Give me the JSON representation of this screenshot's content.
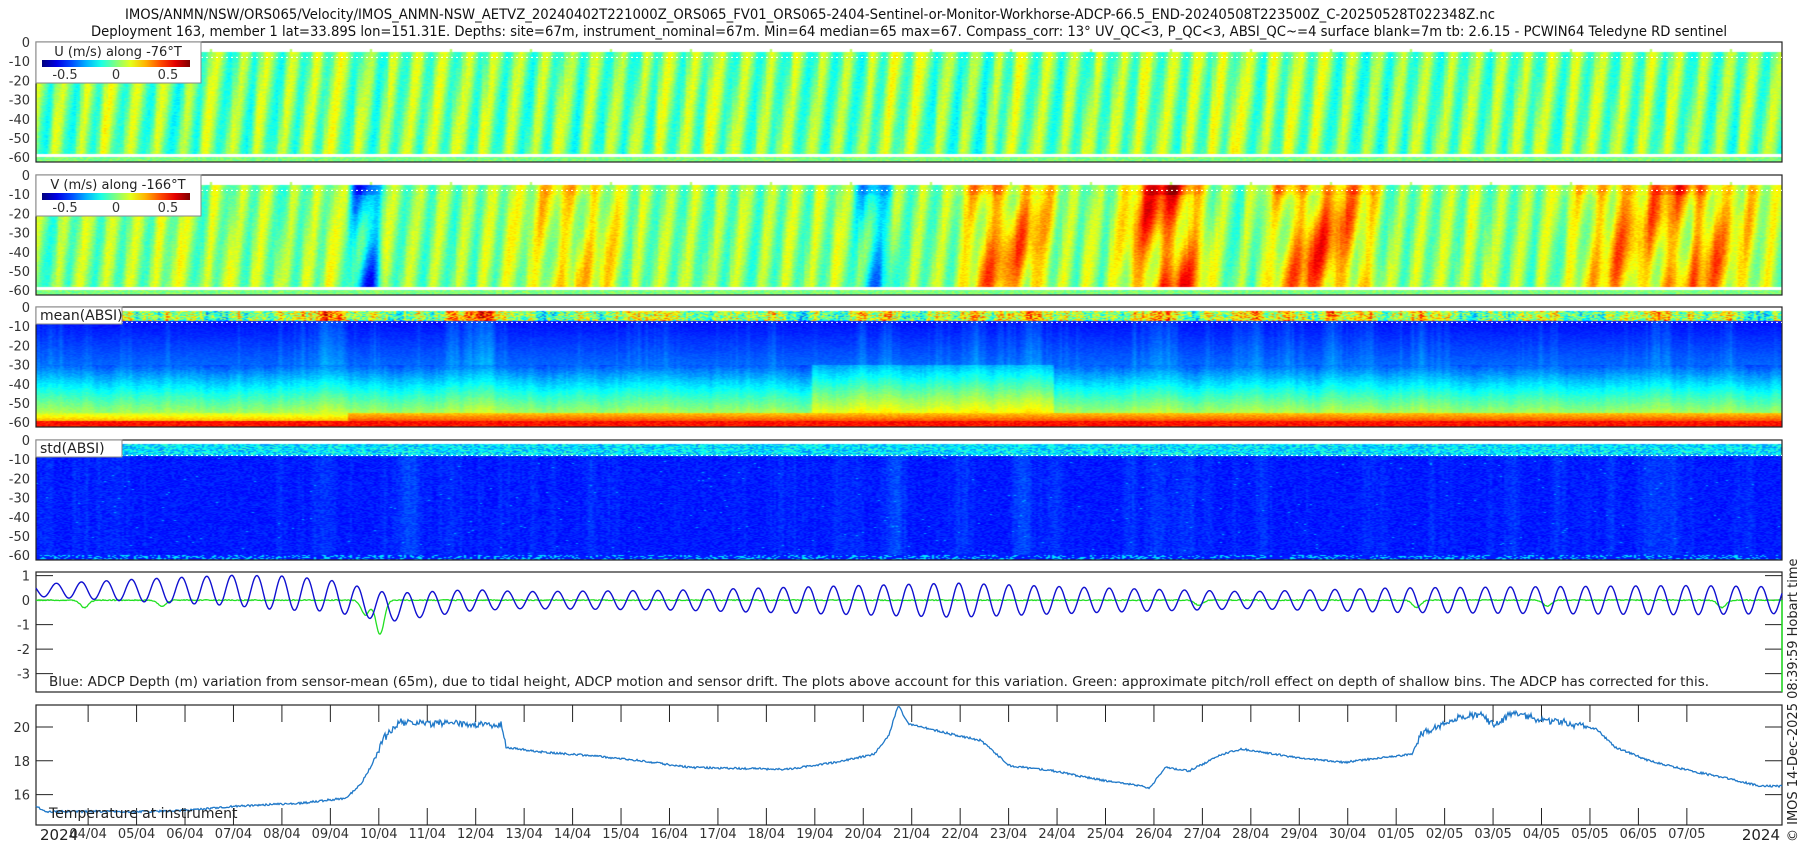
{
  "header": {
    "title_line1": "IMOS/ANMN/NSW/ORS065/Velocity/IMOS_ANMN-NSW_AETVZ_20240402T221000Z_ORS065_FV01_ORS065-2404-Sentinel-or-Monitor-Workhorse-ADCP-66.5_END-20240508T223500Z_C-20250528T022348Z.nc",
    "title_line2": "Deployment 163, member 1 lat=33.89S lon=151.31E. Depths: site=67m, instrument_nominal=67m. Min=64 median=65 max=67. Compass_corr: 13° UV_QC<3, P_QC<3, ABSI_QC~=4 surface blank=7m tb: 2.6.15 - PCWIN64 Teledyne RD sentinel"
  },
  "footer": {
    "copyright": "© IMOS 14-Dec-2025 08:39:59 Hobart time",
    "year_left": "2024",
    "year_right": "2024"
  },
  "colors": {
    "depth_line": "#1010d0",
    "pitch_line": "#22e022",
    "temp_line": "#1f78c8"
  },
  "chart_data": [
    {
      "type": "heatmap",
      "id": "u",
      "label": "U (m/s) along -76°T",
      "colormap": "jet",
      "clim": [
        -0.7,
        0.7
      ],
      "colorbar_ticks": [
        "-0.5",
        "0",
        "0.5"
      ],
      "y_ticks": [
        "0",
        "-10",
        "-20",
        "-30",
        "-40",
        "-50",
        "-60"
      ],
      "ylim": [
        0,
        62.5
      ],
      "baseline": 0.0,
      "noise": 0.14,
      "features": []
    },
    {
      "type": "heatmap",
      "id": "v",
      "label": "V (m/s) along -166°T",
      "colormap": "jet",
      "clim": [
        -0.7,
        0.7
      ],
      "colorbar_ticks": [
        "-0.5",
        "0",
        "0.5"
      ],
      "y_ticks": [
        "0",
        "-10",
        "-20",
        "-30",
        "-40",
        "-50",
        "-60"
      ],
      "ylim": [
        0,
        62.5
      ],
      "baseline": 0.02,
      "noise": 0.12,
      "features": [
        {
          "days": [
            6.4,
            7.2
          ],
          "value": -0.55
        },
        {
          "days": [
            9.7,
            12.5
          ],
          "value": 0.22
        },
        {
          "days": [
            16.8,
            17.8
          ],
          "value": -0.35
        },
        {
          "days": [
            18.9,
            21.3
          ],
          "value": 0.45
        },
        {
          "days": [
            22.2,
            24.4
          ],
          "value": 0.55
        },
        {
          "days": [
            25.1,
            27.9
          ],
          "value": 0.5
        },
        {
          "days": [
            31.2,
            36.0
          ],
          "value": 0.4
        }
      ]
    },
    {
      "type": "heatmap",
      "id": "mean",
      "label": "mean(ABSI)",
      "colormap": "jet",
      "y_ticks": [
        "0",
        "-10",
        "-20",
        "-30",
        "-40",
        "-50",
        "-60"
      ],
      "ylim": [
        0,
        62.5
      ]
    },
    {
      "type": "heatmap",
      "id": "std",
      "label": "std(ABSI)",
      "colormap": "jet",
      "y_ticks": [
        "0",
        "-10",
        "-20",
        "-30",
        "-40",
        "-50",
        "-60"
      ],
      "ylim": [
        0,
        62.5
      ]
    },
    {
      "type": "line",
      "id": "depth",
      "caption": "Blue: ADCP Depth (m) variation from sensor-mean (65m), due to tidal height, ADCP motion and sensor drift. The plots above account for this variation. Green: approximate pitch/roll effect on depth of shallow bins. The ADCP has corrected for this.",
      "ylim": [
        3.75,
        -1.15
      ],
      "y_ticks": [
        {
          "v": -1,
          "label": "1"
        },
        {
          "v": 0,
          "label": "0"
        },
        {
          "v": 1,
          "label": "-1"
        },
        {
          "v": 2,
          "label": "-2"
        },
        {
          "v": 3,
          "label": "-3"
        }
      ],
      "tide_period_days": 0.5175,
      "tide_amplitude": [
        [
          0,
          0.25
        ],
        [
          2,
          0.45
        ],
        [
          5,
          0.7
        ],
        [
          7,
          0.6
        ],
        [
          10,
          0.35
        ],
        [
          13,
          0.4
        ],
        [
          16,
          0.55
        ],
        [
          19,
          0.7
        ],
        [
          22,
          0.5
        ],
        [
          25,
          0.35
        ],
        [
          28,
          0.5
        ],
        [
          31,
          0.55
        ],
        [
          34,
          0.6
        ],
        [
          36,
          0.55
        ]
      ],
      "mean_offset": [
        [
          0,
          -0.4
        ],
        [
          4,
          -0.4
        ],
        [
          6,
          -0.2
        ],
        [
          7.3,
          0.3
        ],
        [
          9,
          0
        ],
        [
          36,
          0
        ]
      ],
      "pitch_dips": [
        [
          1.0,
          0.3
        ],
        [
          2.6,
          0.25
        ],
        [
          6.8,
          0.6
        ],
        [
          7.1,
          1.4
        ],
        [
          24.0,
          0.2
        ],
        [
          28.5,
          0.3
        ],
        [
          31.2,
          0.25
        ],
        [
          34.8,
          0.3
        ]
      ]
    },
    {
      "type": "line",
      "id": "temp",
      "label": "Temperature at instrument",
      "ylim": [
        14.2,
        21.3
      ],
      "y_ticks": [
        "16",
        "18",
        "20"
      ],
      "xlabel_ticks": [
        "04/04",
        "05/04",
        "06/04",
        "07/04",
        "08/04",
        "09/04",
        "10/04",
        "11/04",
        "12/04",
        "13/04",
        "14/04",
        "15/04",
        "16/04",
        "17/04",
        "18/04",
        "19/04",
        "20/04",
        "21/04",
        "22/04",
        "23/04",
        "24/04",
        "25/04",
        "26/04",
        "27/04",
        "28/04",
        "29/04",
        "30/04",
        "01/05",
        "02/05",
        "03/05",
        "04/05",
        "05/05",
        "06/05",
        "07/05"
      ],
      "first_tick_day": 1.076,
      "total_days": 36.04,
      "points": [
        [
          0,
          15.3
        ],
        [
          0.2,
          15.0
        ],
        [
          2.5,
          15.0
        ],
        [
          3.3,
          15.1
        ],
        [
          4.0,
          15.3
        ],
        [
          5.5,
          15.5
        ],
        [
          6.4,
          15.8
        ],
        [
          6.7,
          16.6
        ],
        [
          6.9,
          17.6
        ],
        [
          7.2,
          19.4
        ],
        [
          7.5,
          20.3
        ],
        [
          8.5,
          20.2
        ],
        [
          9.6,
          20.1
        ],
        [
          9.7,
          18.8
        ],
        [
          10.5,
          18.5
        ],
        [
          11.5,
          18.3
        ],
        [
          12.5,
          18.0
        ],
        [
          13.5,
          17.6
        ],
        [
          15.5,
          17.5
        ],
        [
          16.5,
          17.9
        ],
        [
          17.3,
          18.4
        ],
        [
          17.6,
          19.5
        ],
        [
          17.8,
          21.3
        ],
        [
          18.0,
          20.2
        ],
        [
          19.0,
          19.5
        ],
        [
          19.5,
          19.2
        ],
        [
          20.1,
          17.7
        ],
        [
          21.0,
          17.4
        ],
        [
          21.9,
          16.9
        ],
        [
          22.4,
          16.7
        ],
        [
          23.0,
          16.4
        ],
        [
          23.3,
          17.6
        ],
        [
          23.8,
          17.4
        ],
        [
          24.5,
          18.4
        ],
        [
          24.9,
          18.7
        ],
        [
          26.0,
          18.2
        ],
        [
          27.0,
          17.9
        ],
        [
          27.8,
          18.2
        ],
        [
          28.4,
          18.4
        ],
        [
          28.6,
          19.6
        ],
        [
          29.4,
          20.6
        ],
        [
          29.8,
          20.8
        ],
        [
          30.1,
          20.1
        ],
        [
          30.5,
          20.9
        ],
        [
          31.0,
          20.4
        ],
        [
          31.5,
          20.3
        ],
        [
          32.2,
          19.9
        ],
        [
          32.6,
          18.8
        ],
        [
          33.3,
          18.0
        ],
        [
          34.0,
          17.5
        ],
        [
          35.0,
          16.9
        ],
        [
          35.6,
          16.5
        ],
        [
          36.04,
          16.5
        ]
      ]
    }
  ]
}
